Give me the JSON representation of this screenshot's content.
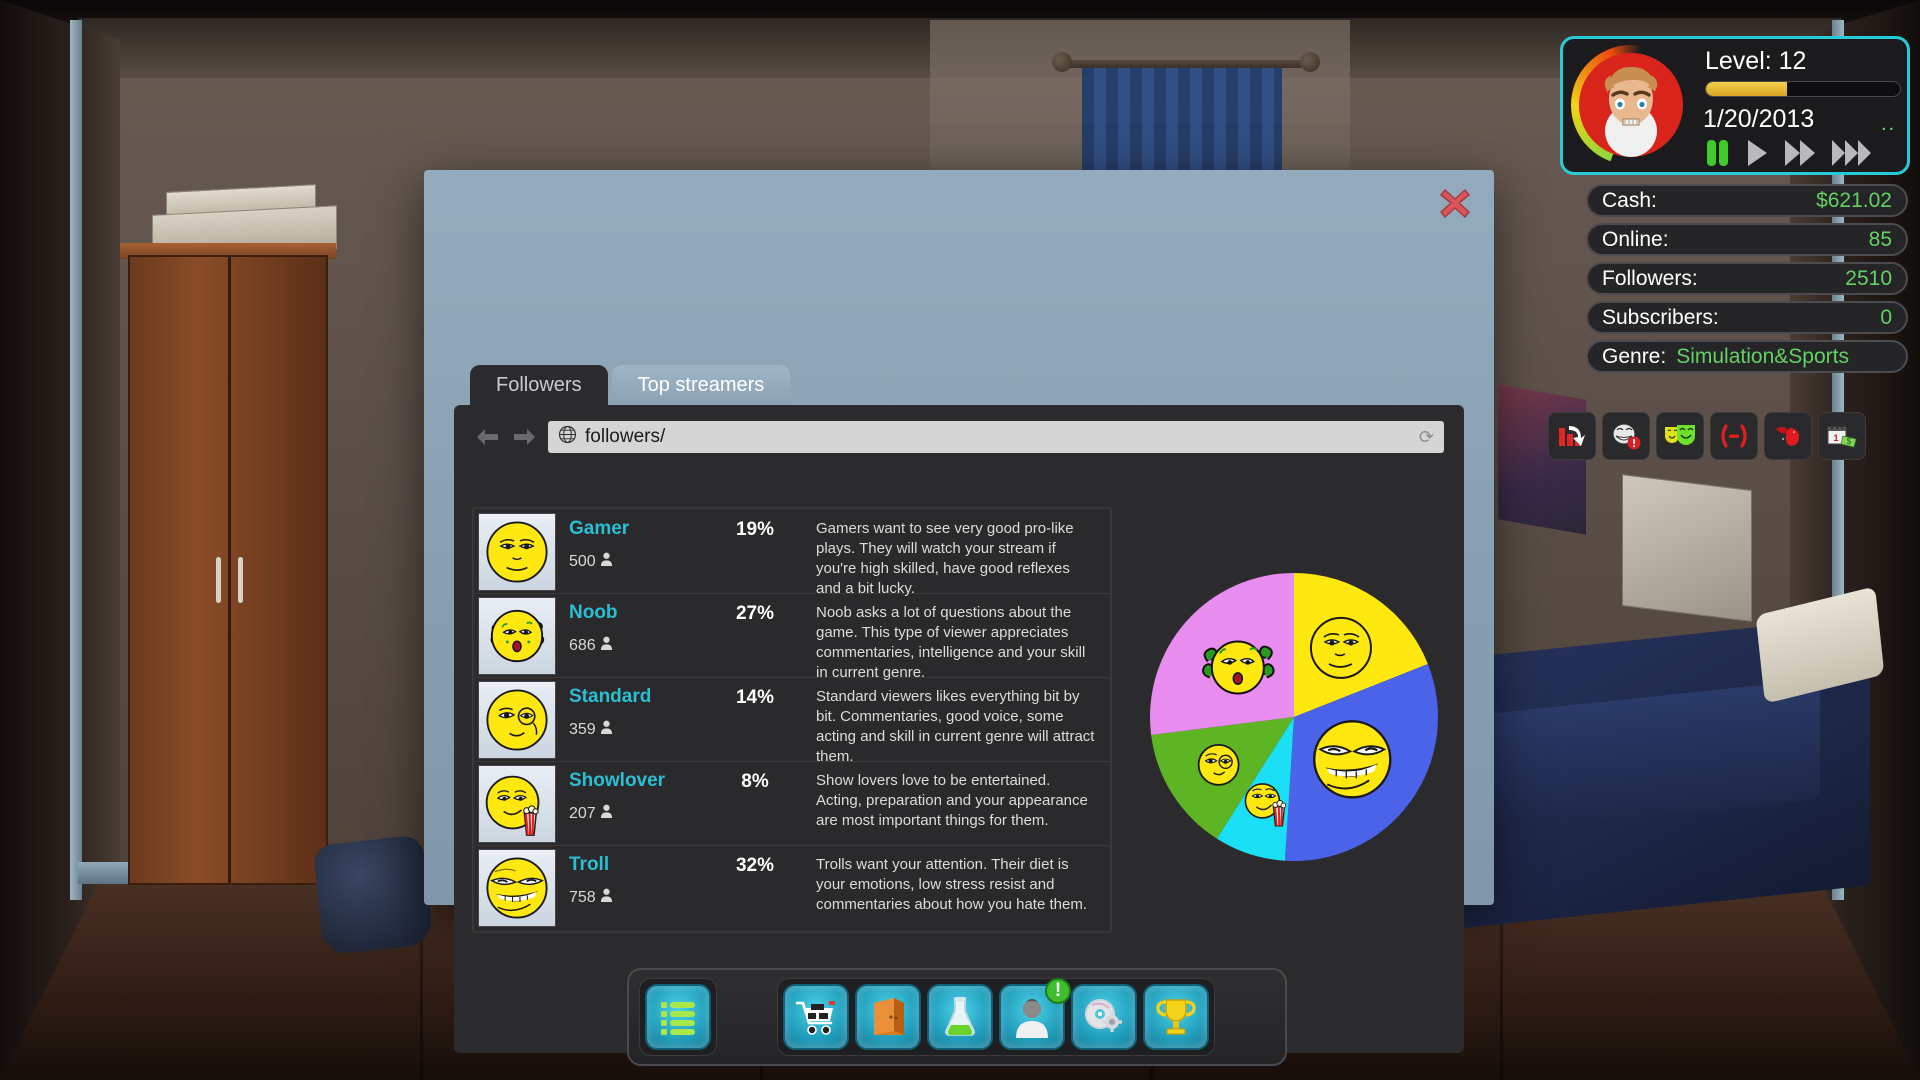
{
  "hud": {
    "level_label": "Level: 12",
    "xp_percent": 42,
    "date": "1/20/2013",
    "dots": "..",
    "speed_controls": [
      {
        "name": "pause-button",
        "label": "Pause"
      },
      {
        "name": "play-button",
        "label": "Play"
      },
      {
        "name": "fast-forward-button",
        "label": "Fast forward"
      },
      {
        "name": "ultra-forward-button",
        "label": "Ultra fast forward"
      }
    ],
    "stats": [
      {
        "label": "Cash:",
        "value": "$621.02"
      },
      {
        "label": "Online:",
        "value": "85"
      },
      {
        "label": "Followers:",
        "value": "2510"
      },
      {
        "label": "Subscribers:",
        "value": "0"
      }
    ],
    "genre": {
      "label": "Genre:",
      "value": "Simulation&Sports"
    }
  },
  "browser": {
    "close_label": "✕",
    "tabs": [
      {
        "label": "Followers",
        "active": true
      },
      {
        "label": "Top streamers",
        "active": false
      }
    ],
    "nav": {
      "back": "←",
      "forward": "→",
      "reload": "⟳"
    },
    "url": "followers/",
    "url_placeholder": "followers/"
  },
  "followers": [
    {
      "name": "Gamer",
      "count": "500",
      "percent": "19%",
      "description": "Gamers want to see very good pro-like plays. They will watch your stream if you're high skilled, have good reflexes and a bit lucky.",
      "avatar": "gamer-face-icon",
      "color": "#FFE710"
    },
    {
      "name": "Noob",
      "count": "686",
      "percent": "27%",
      "description": "Noob asks a lot of questions about the game. This type of viewer appreciates commentaries, intelligence and your skill in current genre.",
      "avatar": "noob-face-icon",
      "color": "#E88CF0"
    },
    {
      "name": "Standard",
      "count": "359",
      "percent": "14%",
      "description": "Standard viewers likes everything bit by bit. Commentaries, good voice, some acting and skill in current genre will attract them.",
      "avatar": "standard-face-icon",
      "color": "#5DB524"
    },
    {
      "name": "Showlover",
      "count": "207",
      "percent": "8%",
      "description": "Show lovers love to be entertained. Acting, preparation and your appearance are most important things for them.",
      "avatar": "showlover-face-icon",
      "color": "#1BE0F5"
    },
    {
      "name": "Troll",
      "count": "758",
      "percent": "32%",
      "description": "Trolls want your attention. Their diet is your emotions, low stress resist and commentaries about how you hate them.",
      "avatar": "troll-face-icon",
      "color": "#4A63E8"
    }
  ],
  "chart_data": {
    "type": "pie",
    "title": "Follower type distribution",
    "categories": [
      "Gamer",
      "Noob",
      "Standard",
      "Showlover",
      "Troll"
    ],
    "values": [
      19,
      27,
      14,
      8,
      32
    ],
    "counts": [
      500,
      686,
      359,
      207,
      758
    ],
    "colors": [
      "#FFE710",
      "#E88CF0",
      "#5DB524",
      "#1BE0F5",
      "#4A63E8"
    ],
    "unit": "%",
    "legend": "none",
    "labels_shown": "avatar-icons-inside-slices"
  },
  "wall_icons": [
    {
      "name": "stats-drop-icon",
      "label": "Rating drop"
    },
    {
      "name": "troll-alert-icon",
      "label": "Troll alert"
    },
    {
      "name": "acting-masks-icon",
      "label": "Acting"
    },
    {
      "name": "stress-icon",
      "label": "Stress"
    },
    {
      "name": "blood-icon",
      "label": "Health"
    },
    {
      "name": "rent-calendar-icon",
      "label": "Rent due"
    }
  ],
  "dock": {
    "menu_button": {
      "name": "menu-button",
      "label": "Menu"
    },
    "buttons": [
      {
        "name": "shop-button",
        "label": "Shop",
        "badge": ""
      },
      {
        "name": "inventory-button",
        "label": "Inventory",
        "badge": ""
      },
      {
        "name": "skills-button",
        "label": "Skills",
        "badge": ""
      },
      {
        "name": "character-button",
        "label": "Character",
        "badge": "!"
      },
      {
        "name": "settings-button",
        "label": "Settings",
        "badge": ""
      },
      {
        "name": "achievements-button",
        "label": "Achievements",
        "badge": ""
      }
    ]
  },
  "theme": {
    "accent_cyan": "#27cbd8",
    "name_cyan": "#2bbfd4",
    "money_green": "#63d263",
    "panel_dark": "#2b2b2d",
    "browser_chrome": "#93abbc"
  }
}
